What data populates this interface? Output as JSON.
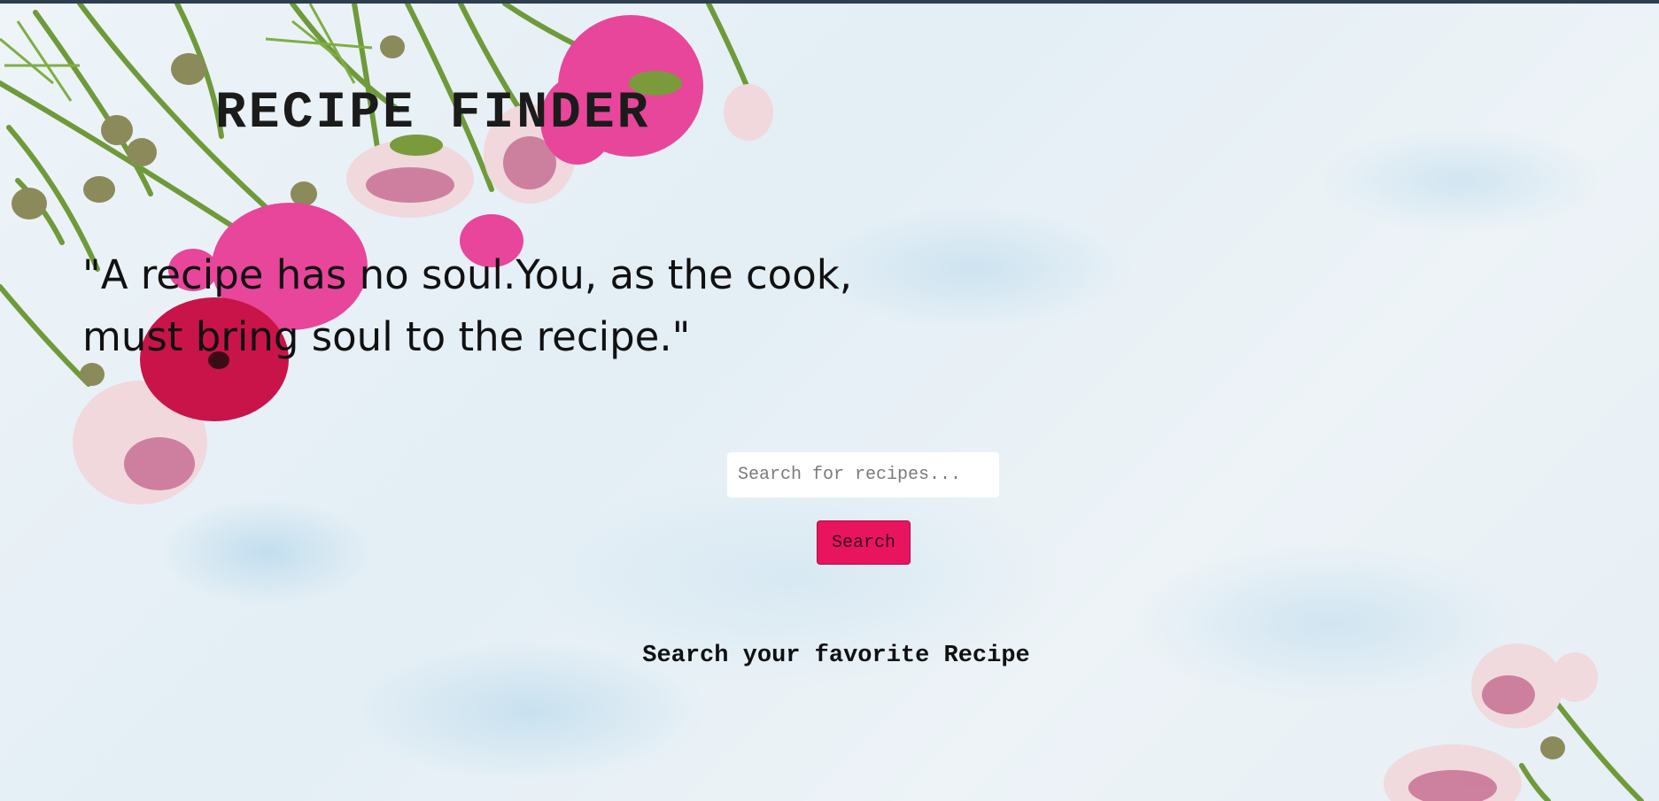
{
  "header": {
    "title": "RECIPE FINDER"
  },
  "hero": {
    "quote": "\"A recipe has no soul.You, as the cook, must bring soul to the recipe.\""
  },
  "search": {
    "placeholder": "Search for recipes...",
    "value": "",
    "button_label": "Search"
  },
  "results": {
    "message": "Search your favorite Recipe"
  },
  "colors": {
    "accent": "#e8155e",
    "background": "#e8f0f5",
    "text": "#111111"
  },
  "decorations": {
    "top_left": "ranunculus-flowers-image",
    "bottom_right": "ranunculus-flowers-image"
  }
}
